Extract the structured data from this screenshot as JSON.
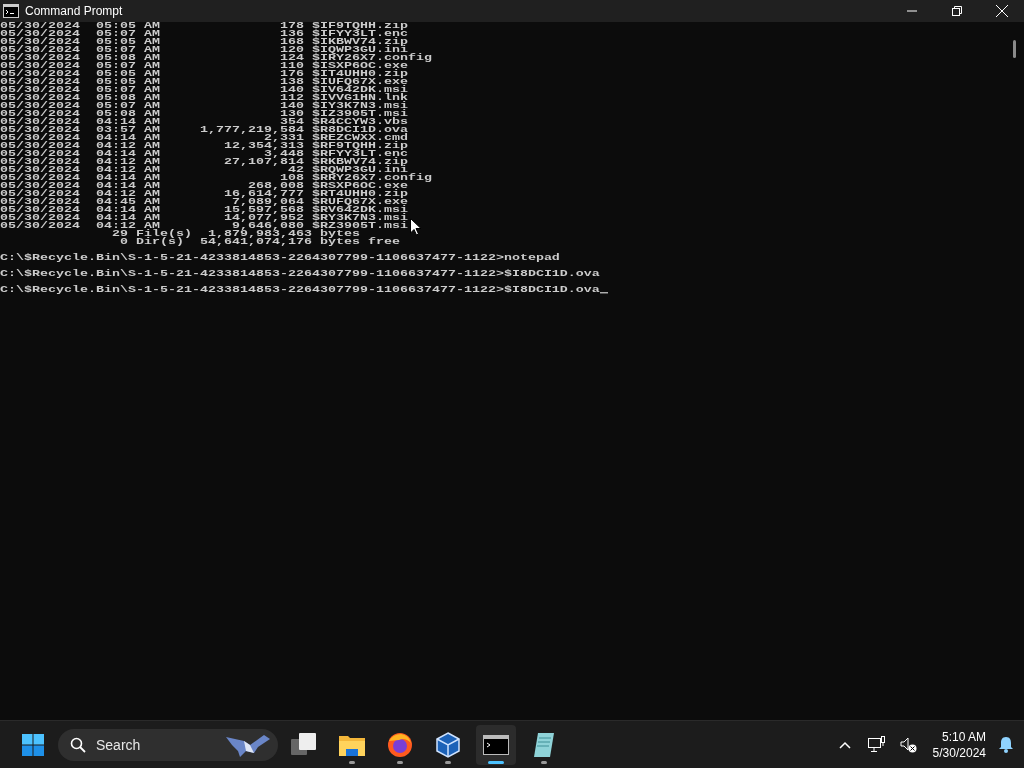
{
  "window": {
    "title": "Command Prompt"
  },
  "console": {
    "listing": [
      {
        "date": "05/30/2024",
        "time": "05:05 AM",
        "size": "178",
        "name": "$IF9TQHH.zip"
      },
      {
        "date": "05/30/2024",
        "time": "05:07 AM",
        "size": "136",
        "name": "$IFYY3LT.enc"
      },
      {
        "date": "05/30/2024",
        "time": "05:05 AM",
        "size": "168",
        "name": "$IKBWV74.zip"
      },
      {
        "date": "05/30/2024",
        "time": "05:07 AM",
        "size": "120",
        "name": "$IQWP3GU.ini"
      },
      {
        "date": "05/30/2024",
        "time": "05:08 AM",
        "size": "124",
        "name": "$IRY26X7.config"
      },
      {
        "date": "05/30/2024",
        "time": "05:07 AM",
        "size": "110",
        "name": "$ISXP6OC.exe"
      },
      {
        "date": "05/30/2024",
        "time": "05:05 AM",
        "size": "176",
        "name": "$IT4UHH0.zip"
      },
      {
        "date": "05/30/2024",
        "time": "05:05 AM",
        "size": "138",
        "name": "$IUFQ67X.exe"
      },
      {
        "date": "05/30/2024",
        "time": "05:07 AM",
        "size": "140",
        "name": "$IV642DK.msi"
      },
      {
        "date": "05/30/2024",
        "time": "05:08 AM",
        "size": "112",
        "name": "$IVVG1HN.lnk"
      },
      {
        "date": "05/30/2024",
        "time": "05:07 AM",
        "size": "140",
        "name": "$IY3K7N3.msi"
      },
      {
        "date": "05/30/2024",
        "time": "05:08 AM",
        "size": "130",
        "name": "$IZ3905T.msi"
      },
      {
        "date": "05/30/2024",
        "time": "04:14 AM",
        "size": "354",
        "name": "$R4CCYW3.vbs"
      },
      {
        "date": "05/30/2024",
        "time": "03:57 AM",
        "size": "1,777,219,584",
        "name": "$R8DCI1D.ova"
      },
      {
        "date": "05/30/2024",
        "time": "04:14 AM",
        "size": "2,331",
        "name": "$REZCWXX.cmd"
      },
      {
        "date": "05/30/2024",
        "time": "04:12 AM",
        "size": "12,354,313",
        "name": "$RF9TQHH.zip"
      },
      {
        "date": "05/30/2024",
        "time": "04:14 AM",
        "size": "3,448",
        "name": "$RFYY3LT.enc"
      },
      {
        "date": "05/30/2024",
        "time": "04:12 AM",
        "size": "27,107,814",
        "name": "$RKBWV74.zip"
      },
      {
        "date": "05/30/2024",
        "time": "04:12 AM",
        "size": "42",
        "name": "$RQWP3GU.ini"
      },
      {
        "date": "05/30/2024",
        "time": "04:14 AM",
        "size": "108",
        "name": "$RRY26X7.config"
      },
      {
        "date": "05/30/2024",
        "time": "04:14 AM",
        "size": "268,008",
        "name": "$RSXP6OC.exe"
      },
      {
        "date": "05/30/2024",
        "time": "04:12 AM",
        "size": "16,614,777",
        "name": "$RT4UHH0.zip"
      },
      {
        "date": "05/30/2024",
        "time": "04:45 AM",
        "size": "7,089,064",
        "name": "$RUFQ67X.exe"
      },
      {
        "date": "05/30/2024",
        "time": "04:14 AM",
        "size": "15,597,568",
        "name": "$RV642DK.msi"
      },
      {
        "date": "05/30/2024",
        "time": "04:14 AM",
        "size": "14,077,952",
        "name": "$RY3K7N3.msi"
      },
      {
        "date": "05/30/2024",
        "time": "04:12 AM",
        "size": "9,646,080",
        "name": "$RZ3905T.msi"
      }
    ],
    "summary": [
      "              29 File(s)  1,879,983,463 bytes",
      "               0 Dir(s)  54,641,074,176 bytes free"
    ],
    "prompts": [
      {
        "path": "C:\\$Recycle.Bin\\S-1-5-21-4233814853-2264307799-1106637477-1122>",
        "command": "notepad",
        "cursor": false
      },
      {
        "path": "C:\\$Recycle.Bin\\S-1-5-21-4233814853-2264307799-1106637477-1122>",
        "command": "$I8DCI1D.ova",
        "cursor": false
      },
      {
        "path": "C:\\$Recycle.Bin\\S-1-5-21-4233814853-2264307799-1106637477-1122>",
        "command": "$I8DCI1D.ova",
        "cursor": true
      }
    ]
  },
  "taskbar": {
    "search": {
      "placeholder": "Search"
    },
    "apps": [
      {
        "kind": "task-view",
        "running": false,
        "selected": false
      },
      {
        "kind": "folder",
        "running": true,
        "selected": false
      },
      {
        "kind": "browser",
        "running": true,
        "selected": false
      },
      {
        "kind": "cube",
        "running": true,
        "selected": false
      },
      {
        "kind": "terminal",
        "running": true,
        "selected": true
      },
      {
        "kind": "notepad",
        "running": true,
        "selected": false
      }
    ],
    "clock": {
      "time": "5:10 AM",
      "date": "5/30/2024"
    }
  }
}
